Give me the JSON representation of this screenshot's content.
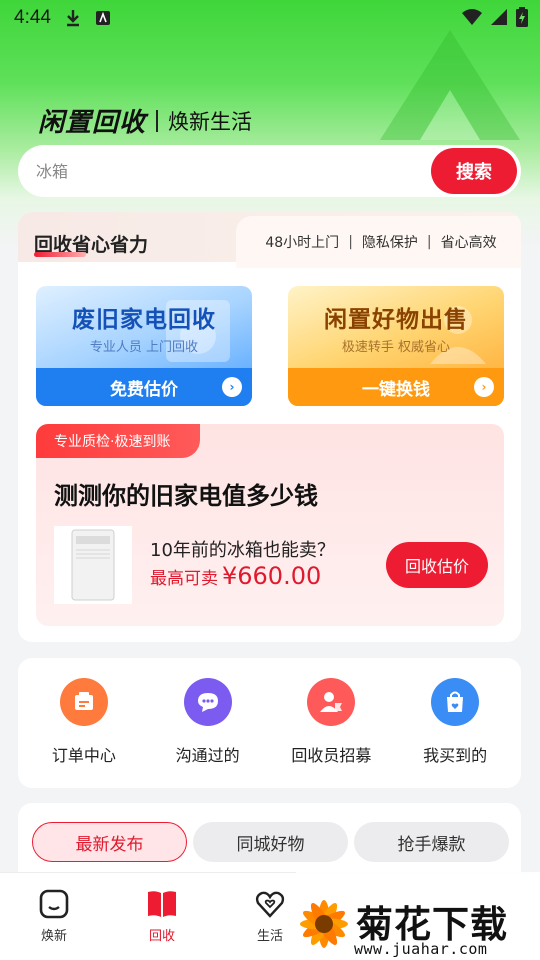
{
  "status_bar": {
    "time": "4:44"
  },
  "brand": {
    "name": "闲置回收",
    "slogan": "焕新生活"
  },
  "search": {
    "placeholder": "冰箱",
    "button_label": "搜索"
  },
  "main_card": {
    "title": "回收省心省力",
    "tags": [
      "48小时上门",
      "隐私保护",
      "省心高效"
    ],
    "services": [
      {
        "title": "废旧家电回收",
        "subtitle": "专业人员 上门回收",
        "action": "免费估价"
      },
      {
        "title": "闲置好物出售",
        "subtitle": "极速转手 权威省心",
        "action": "一键换钱"
      }
    ],
    "valuation": {
      "badge": "专业质检·极速到账",
      "title": "测测你的旧家电值多少钱",
      "question": "10年前的冰箱也能卖？",
      "price_label": "最高可卖",
      "price": "¥660.00",
      "button_label": "回收估价"
    }
  },
  "quick_actions": [
    {
      "label": "订单中心",
      "icon": "order-icon",
      "color": "#ff7a3d"
    },
    {
      "label": "沟通过的",
      "icon": "chat-icon",
      "color": "#7c5cf0"
    },
    {
      "label": "回收员招募",
      "icon": "recruit-icon",
      "color": "#ff5a5a"
    },
    {
      "label": "我买到的",
      "icon": "shopping-bag-icon",
      "color": "#3a8df5"
    }
  ],
  "feed_tabs": [
    {
      "label": "最新发布",
      "active": true
    },
    {
      "label": "同城好物",
      "active": false
    },
    {
      "label": "抢手爆款",
      "active": false
    }
  ],
  "bottom_nav": [
    {
      "label": "焕新",
      "icon": "face-icon",
      "active": false
    },
    {
      "label": "回收",
      "icon": "book-icon",
      "active": true
    },
    {
      "label": "生活",
      "icon": "heart-icon",
      "active": false
    }
  ],
  "watermark": {
    "name": "菊花下载网",
    "url": "www.juahar.com"
  },
  "colors": {
    "primary_red": "#ee1c33",
    "green": "#3fd63a",
    "blue": "#1f7ff0",
    "orange": "#ff9a10"
  }
}
